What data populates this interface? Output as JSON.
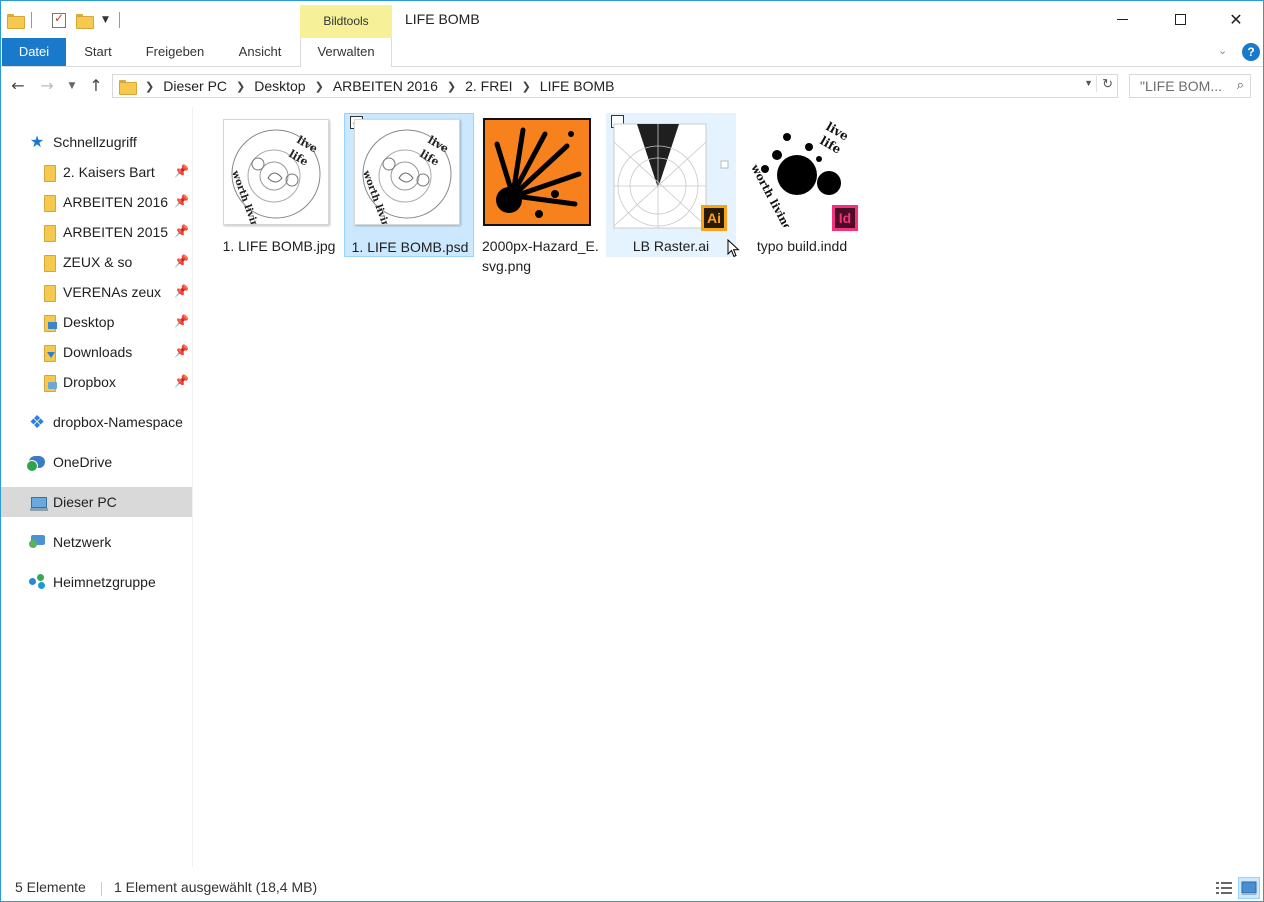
{
  "window": {
    "title": "LIFE BOMB",
    "context_tab": "Bildtools"
  },
  "ribbon": {
    "tabs": [
      "Datei",
      "Start",
      "Freigeben",
      "Ansicht",
      "Verwalten"
    ],
    "accent_color": "#1979CA",
    "context_color": "#F6F098"
  },
  "address": {
    "crumbs": [
      "Dieser PC",
      "Desktop",
      "ARBEITEN 2016",
      "2. FREI",
      "LIFE BOMB"
    ]
  },
  "search": {
    "placeholder": "\"LIFE BOM..."
  },
  "sidebar": {
    "quick_access": "Schnellzugriff",
    "pinned": [
      "2. Kaisers Bart",
      "ARBEITEN 2016",
      "ARBEITEN 2015",
      "ZEUX & so",
      "VERENAs zeux",
      "Desktop",
      "Downloads",
      "Dropbox"
    ],
    "dropbox": "dropbox-Namespace",
    "onedrive": "OneDrive",
    "this_pc": "Dieser PC",
    "network": "Netzwerk",
    "homegroup": "Heimnetzgruppe"
  },
  "files": [
    {
      "name": "1. LIFE BOMB.jpg",
      "state": "normal"
    },
    {
      "name": "1. LIFE BOMB.psd",
      "state": "selected"
    },
    {
      "name": "2000px-Hazard_E.svg.png",
      "state": "normal"
    },
    {
      "name": "LB Raster.ai",
      "state": "hover"
    },
    {
      "name": "typo build.indd",
      "state": "normal"
    }
  ],
  "thumb_text": {
    "top": "live",
    "middle": "life",
    "bottom": "worth living"
  },
  "badges": {
    "ai": "Ai",
    "id": "Id"
  },
  "status": {
    "count": "5 Elemente",
    "selection": "1 Element ausgewählt (18,4 MB)"
  }
}
